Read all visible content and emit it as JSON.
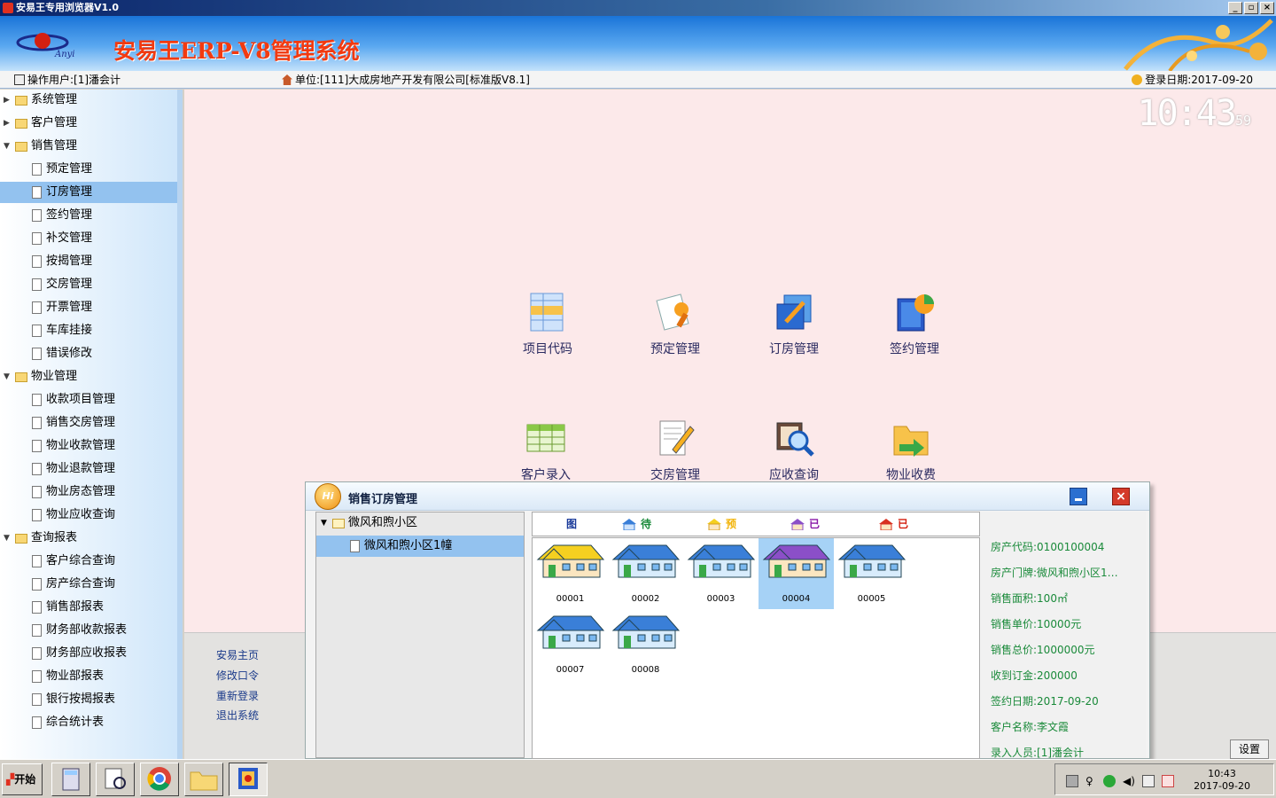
{
  "window": {
    "title": "安易王专用浏览器V1.0"
  },
  "banner": {
    "title": "安易王ERP-V8管理系统",
    "logo_text": "Anyi"
  },
  "infobar": {
    "user": "操作用户:[1]潘会计",
    "unit": "单位:[111]大成房地产开发有限公司[标准版V8.1]",
    "date": "登录日期:2017-09-20"
  },
  "clock": {
    "time": "10:43",
    "seconds": "59"
  },
  "sidebar": {
    "items": [
      {
        "label": "系统管理",
        "type": "folder",
        "state": "collapsed"
      },
      {
        "label": "客户管理",
        "type": "folder",
        "state": "collapsed"
      },
      {
        "label": "销售管理",
        "type": "folder",
        "state": "expanded"
      },
      {
        "label": "预定管理",
        "type": "page"
      },
      {
        "label": "订房管理",
        "type": "page",
        "selected": true
      },
      {
        "label": "签约管理",
        "type": "page"
      },
      {
        "label": "补交管理",
        "type": "page"
      },
      {
        "label": "按揭管理",
        "type": "page"
      },
      {
        "label": "交房管理",
        "type": "page"
      },
      {
        "label": "开票管理",
        "type": "page"
      },
      {
        "label": "车库挂接",
        "type": "page"
      },
      {
        "label": "错误修改",
        "type": "page"
      },
      {
        "label": "物业管理",
        "type": "folder",
        "state": "expanded"
      },
      {
        "label": "收款项目管理",
        "type": "page"
      },
      {
        "label": "销售交房管理",
        "type": "page"
      },
      {
        "label": "物业收款管理",
        "type": "page"
      },
      {
        "label": "物业退款管理",
        "type": "page"
      },
      {
        "label": "物业房态管理",
        "type": "page"
      },
      {
        "label": "物业应收查询",
        "type": "page"
      },
      {
        "label": "查询报表",
        "type": "folder",
        "state": "expanded"
      },
      {
        "label": "客户综合查询",
        "type": "page"
      },
      {
        "label": "房产综合查询",
        "type": "page"
      },
      {
        "label": "销售部报表",
        "type": "page"
      },
      {
        "label": "财务部收款报表",
        "type": "page"
      },
      {
        "label": "财务部应收报表",
        "type": "page"
      },
      {
        "label": "物业部报表",
        "type": "page"
      },
      {
        "label": "银行按揭报表",
        "type": "page"
      },
      {
        "label": "综合统计表",
        "type": "page"
      }
    ]
  },
  "desktop": {
    "icons": [
      {
        "label": "项目代码",
        "icon": "table-icon"
      },
      {
        "label": "预定管理",
        "icon": "reservation-icon"
      },
      {
        "label": "订房管理",
        "icon": "booking-icon"
      },
      {
        "label": "签约管理",
        "icon": "contract-icon"
      },
      {
        "label": "客户录入",
        "icon": "spreadsheet-icon"
      },
      {
        "label": "交房管理",
        "icon": "document-edit-icon"
      },
      {
        "label": "应收查询",
        "icon": "magnifier-icon"
      },
      {
        "label": "物业收费",
        "icon": "folder-arrow-icon"
      }
    ]
  },
  "lower_links": [
    "安易主页",
    "修改口令",
    "重新登录",
    "退出系统"
  ],
  "settings_button": "设置",
  "dialog": {
    "title": "销售订房管理",
    "hi_badge": "Hi",
    "tree": [
      {
        "label": "微风和煦小区",
        "level": 0
      },
      {
        "label": "微风和煦小区1幢",
        "level": 1,
        "selected": true
      }
    ],
    "legend": {
      "title": "图例说明",
      "items": [
        {
          "label": "待售房产",
          "color": "#1a8a3a",
          "roof": "#3a7fd8"
        },
        {
          "label": "预定房产",
          "color": "#f2b40a",
          "roof": "#f5d020"
        },
        {
          "label": "已定房产",
          "color": "#8a1aa8",
          "roof": "#8b4fc8"
        },
        {
          "label": "已售房产",
          "color": "#d42010",
          "roof": "#d83020"
        }
      ]
    },
    "houses": [
      {
        "code": "00001",
        "status": "预定房产"
      },
      {
        "code": "00002",
        "status": "待售房产"
      },
      {
        "code": "00003",
        "status": "待售房产"
      },
      {
        "code": "00004",
        "status": "已定房产",
        "selected": true
      },
      {
        "code": "00005",
        "status": "待售房产"
      },
      {
        "code": "00007",
        "status": "待售房产"
      },
      {
        "code": "00008",
        "status": "待售房产"
      }
    ],
    "details": [
      "房产代码:0100100004",
      "房产门牌:微风和煦小区1…",
      "销售面积:100㎡",
      "销售单价:10000元",
      "销售总价:1000000元",
      "收到订金:200000",
      "签约日期:2017-09-20",
      "客户名称:李文霞",
      "录入人员:[1]潘会计"
    ]
  },
  "taskbar": {
    "start_label": "开始",
    "apps": [
      "calculator-icon",
      "document-search-icon",
      "chrome-icon",
      "folder-icon",
      "erp-app-icon"
    ],
    "clock_time": "10:43",
    "clock_date": "2017-09-20"
  }
}
